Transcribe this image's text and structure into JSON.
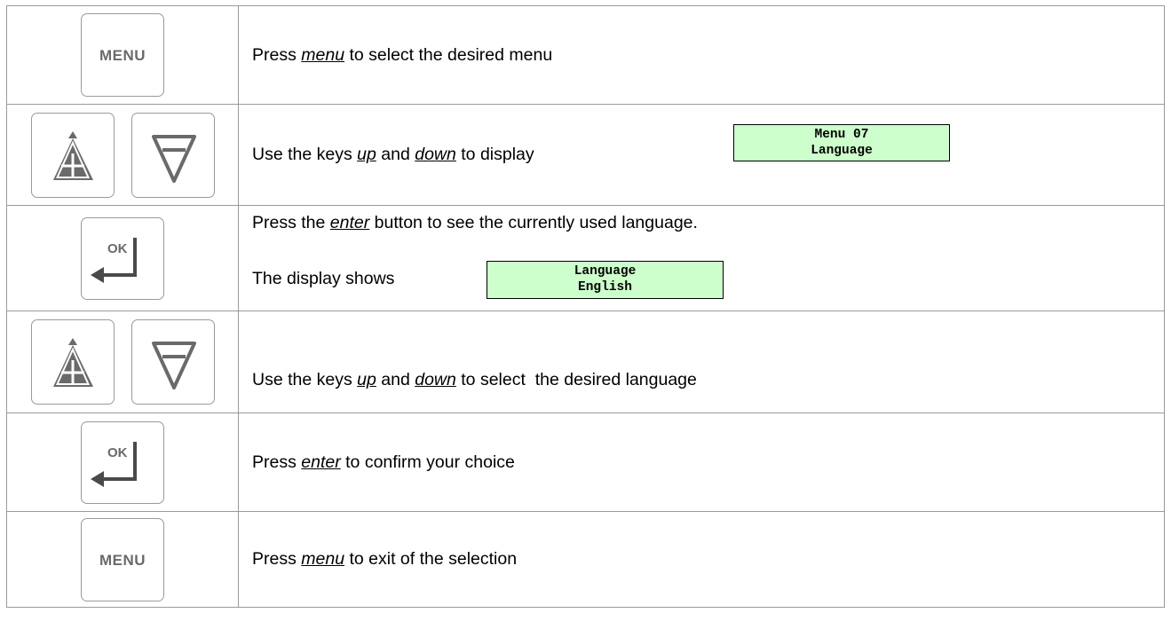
{
  "steps": [
    {
      "keys": [
        {
          "icon": "menu-key-icon",
          "label": "MENU"
        }
      ],
      "text": {
        "before": "Press ",
        "key": "menu",
        "after": " to select the desired menu"
      }
    },
    {
      "keys": [
        {
          "icon": "up-arrow-key-icon"
        },
        {
          "icon": "down-arrow-key-icon"
        }
      ],
      "text": {
        "before": "Use the keys ",
        "key": "up",
        "middle": " and ",
        "key2": "down",
        "after": " to display"
      },
      "display": {
        "line1": "Menu 07",
        "line2": "Language"
      }
    },
    {
      "keys": [
        {
          "icon": "ok-enter-key-icon",
          "label": "OK"
        }
      ],
      "text": {
        "before": "Press the ",
        "key": "enter",
        "after": " button to see the currently used language."
      },
      "text2": "The display shows",
      "display": {
        "line1": "Language",
        "line2": "English"
      }
    },
    {
      "keys": [
        {
          "icon": "up-arrow-key-icon"
        },
        {
          "icon": "down-arrow-key-icon"
        }
      ],
      "text": {
        "before": "Use the keys ",
        "key": "up",
        "middle": " and ",
        "key2": "down",
        "after": " to select  the desired language"
      }
    },
    {
      "keys": [
        {
          "icon": "ok-enter-key-icon",
          "label": "OK"
        }
      ],
      "text": {
        "before": "Press ",
        "key": "enter",
        "after": " to confirm your choice"
      }
    },
    {
      "keys": [
        {
          "icon": "menu-key-icon",
          "label": "MENU"
        }
      ],
      "text": {
        "before": "Press ",
        "key": "menu",
        "after": " to exit of the selection"
      }
    }
  ],
  "colors": {
    "display_bg": "#ccffcc",
    "key_glyph": "#6a6a6a",
    "border": "#9a9a9a"
  }
}
